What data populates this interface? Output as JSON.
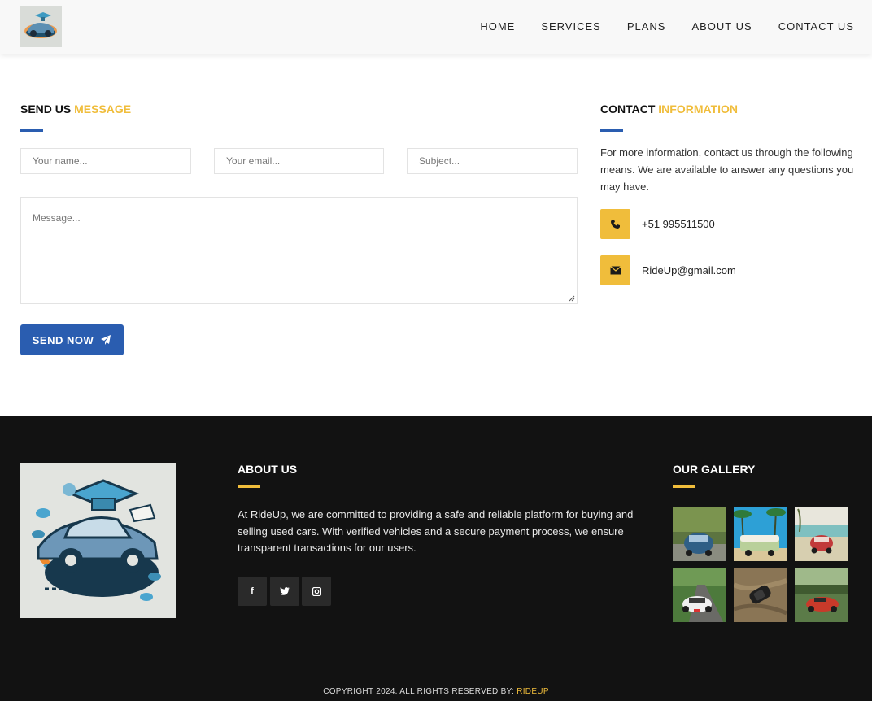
{
  "header": {
    "logo_alt": "RideUp logo",
    "nav": [
      {
        "label": "HOME"
      },
      {
        "label": "SERVICES"
      },
      {
        "label": "PLANS"
      },
      {
        "label": "ABOUT US"
      },
      {
        "label": "CONTACT US"
      }
    ]
  },
  "form": {
    "title_main": "SEND US ",
    "title_highlight": "MESSAGE",
    "name_placeholder": "Your name...",
    "email_placeholder": "Your email...",
    "subject_placeholder": "Subject...",
    "message_placeholder": "Message...",
    "send_label": "SEND NOW"
  },
  "contact": {
    "title_main": "CONTACT ",
    "title_highlight": "INFORMATION",
    "description": "For more information, contact us through the following means. We are available to answer any questions you may have.",
    "phone": "+51 995511500",
    "email": "RideUp@gmail.com"
  },
  "footer": {
    "about_title": "ABOUT US",
    "about_text": "At RideUp, we are committed to providing a safe and reliable platform for buying and selling used cars. With verified vehicles and a secure payment process, we ensure transparent transactions for our users.",
    "social": [
      {
        "icon": "facebook-icon",
        "glyph": "f"
      },
      {
        "icon": "twitter-icon",
        "glyph": "t"
      },
      {
        "icon": "instagram-icon",
        "glyph": "◘"
      }
    ],
    "gallery_title": "OUR GALLERY",
    "gallery": [
      {
        "name": "blue-beetle-forest"
      },
      {
        "name": "green-van-palms"
      },
      {
        "name": "red-beetle-beach"
      },
      {
        "name": "white-sportscar-road"
      },
      {
        "name": "black-car-aerial"
      },
      {
        "name": "red-convertible-field"
      }
    ],
    "copyright_text": "COPYRIGHT 2024. ALL RIGHTS RESERVED BY: ",
    "copyright_brand": "RIDEUP"
  },
  "colors": {
    "accent_yellow": "#f0bd3b",
    "primary_blue": "#2a5db0",
    "footer_bg": "#121212"
  }
}
